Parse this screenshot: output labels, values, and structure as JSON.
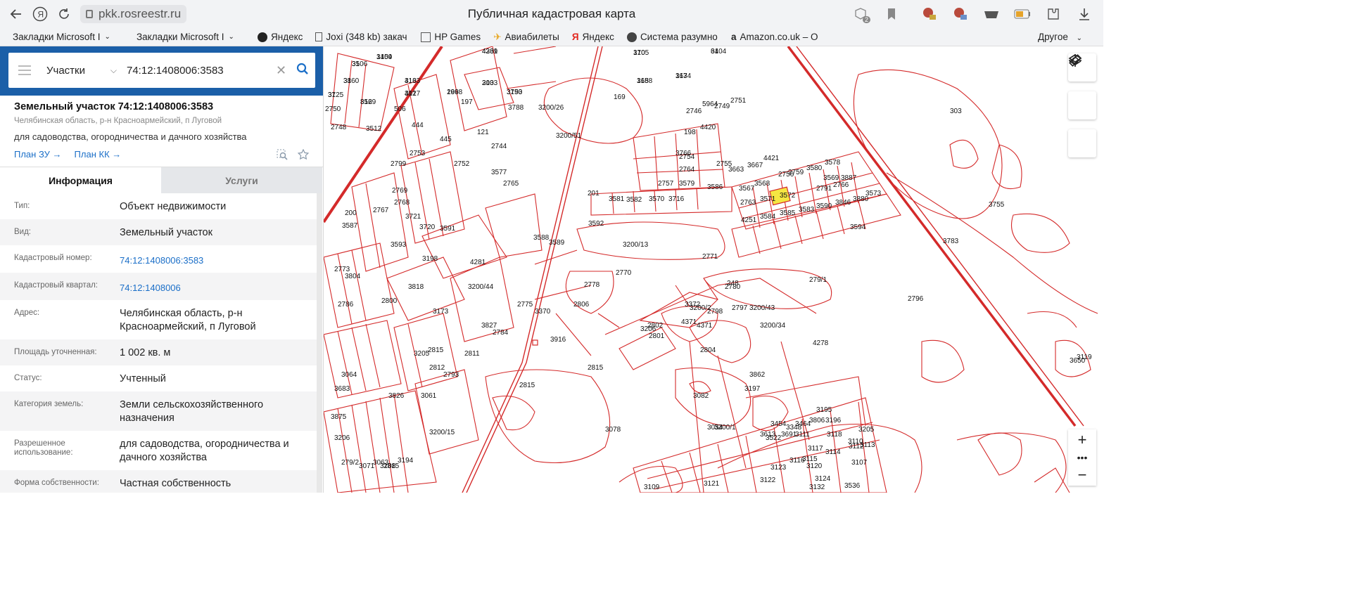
{
  "browser": {
    "url": "pkk.rosreestr.ru",
    "title": "Публичная кадастровая карта",
    "tab_count": "2",
    "bookmarks": [
      {
        "label": "Закладки Microsoft I",
        "icon": "folder-icon"
      },
      {
        "label": "Закладки Microsoft I",
        "icon": "folder-icon"
      },
      {
        "label": "Яндекс",
        "icon": "yandex-icon"
      },
      {
        "label": "Joxi (348 kb) закач",
        "icon": "document-icon"
      },
      {
        "label": "HP Games",
        "icon": "games-icon"
      },
      {
        "label": "Авиабилеты",
        "icon": "plane-icon"
      },
      {
        "label": "Яндекс",
        "icon": "yandex-icon"
      },
      {
        "label": "Система разумно",
        "icon": "globe-icon"
      },
      {
        "label": "Amazon.co.uk – O",
        "icon": "amazon-icon"
      }
    ],
    "bookmarks_other": "Другое"
  },
  "search": {
    "type_label": "Участки",
    "query": "74:12:1408006:3583"
  },
  "object": {
    "title": "Земельный участок 74:12:1408006:3583",
    "address_short": "Челябинская область, р-н Красноармейский, п Луговой",
    "use": "для садоводства, огородничества и дачного хозяйства",
    "plan_zu": "План ЗУ",
    "plan_kk": "План КК"
  },
  "tabs": [
    {
      "label": "Информация",
      "active": true
    },
    {
      "label": "Услуги",
      "active": false
    }
  ],
  "info_rows": [
    {
      "key": "Тип:",
      "value": "Объект недвижимости",
      "link": false
    },
    {
      "key": "Вид:",
      "value": "Земельный участок",
      "link": false
    },
    {
      "key": "Кадастровый номер:",
      "value": "74:12:1408006:3583",
      "link": true
    },
    {
      "key": "Кадастровый квартал:",
      "value": "74:12:1408006",
      "link": true
    },
    {
      "key": "Адрес:",
      "value": "Челябинская область, р-н Красноармейский, п Луговой",
      "link": false
    },
    {
      "key": "Площадь уточненная:",
      "value": "1 002 кв. м",
      "link": false
    },
    {
      "key": "Статус:",
      "value": "Учтенный",
      "link": false
    },
    {
      "key": "Категория земель:",
      "value": "Земли сельскохозяйственного назначения",
      "link": false
    },
    {
      "key": "Разрешенное использование:",
      "value": "для садоводства, огородничества и дачного хозяйства",
      "link": false
    },
    {
      "key": "Форма собственности:",
      "value": "Частная собственность",
      "link": false
    }
  ],
  "map": {
    "line_color": "#d42a2a",
    "highlight_color": "#f5e642",
    "highlighted_parcel": "3583",
    "labels": [
      "4331",
      "170",
      "64",
      "35",
      "1404",
      "38",
      "416",
      "37",
      "196",
      "203",
      "3790",
      "168",
      "167",
      "856",
      "401",
      "197",
      "3788",
      "3200/26",
      "169",
      "2746",
      "2749",
      "2751",
      "2750",
      "506",
      "5964",
      "303",
      "2748",
      "3512",
      "444",
      "445",
      "121",
      "3200/51",
      "198",
      "4420",
      "3766",
      "2753",
      "2752",
      "2744",
      "2754",
      "2755",
      "3663",
      "3667",
      "4421",
      "2764",
      "2756",
      "2759",
      "3580",
      "3578",
      "3579",
      "3577",
      "2765",
      "3586",
      "3567",
      "3568",
      "3569",
      "2799",
      "200",
      "201",
      "2757",
      "3581",
      "3582",
      "3570",
      "3716",
      "3887",
      "2791",
      "2766",
      "2769",
      "2768",
      "2767",
      "2763",
      "3571",
      "3572",
      "3573",
      "3720",
      "3721",
      "4251",
      "3584",
      "3585",
      "3583",
      "3590",
      "3846",
      "3880",
      "3587",
      "3588",
      "3589",
      "3594",
      "3591",
      "3592",
      "3593",
      "3200/13",
      "3755",
      "3783",
      "3198",
      "4281",
      "2770",
      "2771",
      "2773",
      "3804",
      "2778",
      "248",
      "279/1",
      "3818",
      "3200/44",
      "2780",
      "2775",
      "3370",
      "3372",
      "2786",
      "2800",
      "2806",
      "3200/43",
      "3200/2",
      "2798",
      "4371",
      "4371",
      "2797",
      "3173",
      "3827",
      "2784",
      "2804",
      "3206",
      "2796",
      "2801",
      "2802",
      "3916",
      "4278",
      "2815",
      "3205",
      "2793",
      "2811",
      "2812",
      "2815",
      "3200/34",
      "3650",
      "3064",
      "3683",
      "2815",
      "3862",
      "3206",
      "279/2",
      "3071",
      "3063",
      "2815",
      "3194",
      "3061",
      "3082",
      "3875",
      "3826",
      "3200/15",
      "3197",
      "3200/1",
      "3078",
      "3613",
      "3195",
      "3119",
      "3054",
      "3454",
      "3348",
      "3464",
      "3806",
      "3196",
      "3110",
      "3117",
      "3118",
      "3205",
      "3522",
      "3691",
      "3111",
      "3112",
      "3113",
      "3114",
      "3115",
      "3116",
      "3123",
      "3120",
      "3107",
      "3108",
      "3109",
      "3121",
      "3122",
      "3124",
      "3132",
      "3536",
      "4269",
      "3105",
      "3104",
      "3106",
      "3159",
      "3160",
      "3133",
      "3125",
      "2698",
      "3103",
      "3153",
      "3158",
      "3134",
      "3129",
      "3127"
    ]
  }
}
